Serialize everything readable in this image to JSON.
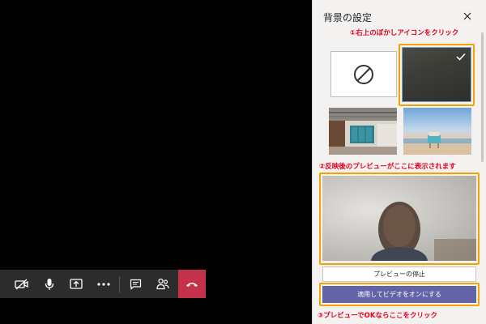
{
  "panel": {
    "title": "背景の設定",
    "close_icon": "close-icon",
    "backgrounds": [
      {
        "name": "none",
        "icon": "no-background-icon"
      },
      {
        "name": "blur",
        "selected": true,
        "icon": "checkmark-icon"
      },
      {
        "name": "office"
      },
      {
        "name": "beach"
      }
    ],
    "stop_preview_label": "プレビューの停止",
    "apply_label": "適用してビデオをオンにする"
  },
  "annotations": {
    "step1": "①右上のぼかしアイコンをクリック",
    "step2": "②反映後のプレビューがここに表示されます",
    "step3": "③プレビューでOKならここをクリック"
  },
  "call_bar": {
    "buttons": [
      "video-off-icon",
      "microphone-icon",
      "share-screen-icon",
      "more-options-icon",
      "chat-icon",
      "participants-icon",
      "hang-up-icon"
    ]
  },
  "colors": {
    "annotation": "#e8001c",
    "highlight": "#f5a300",
    "accent": "#6264a7",
    "hangup": "#c4314b"
  }
}
